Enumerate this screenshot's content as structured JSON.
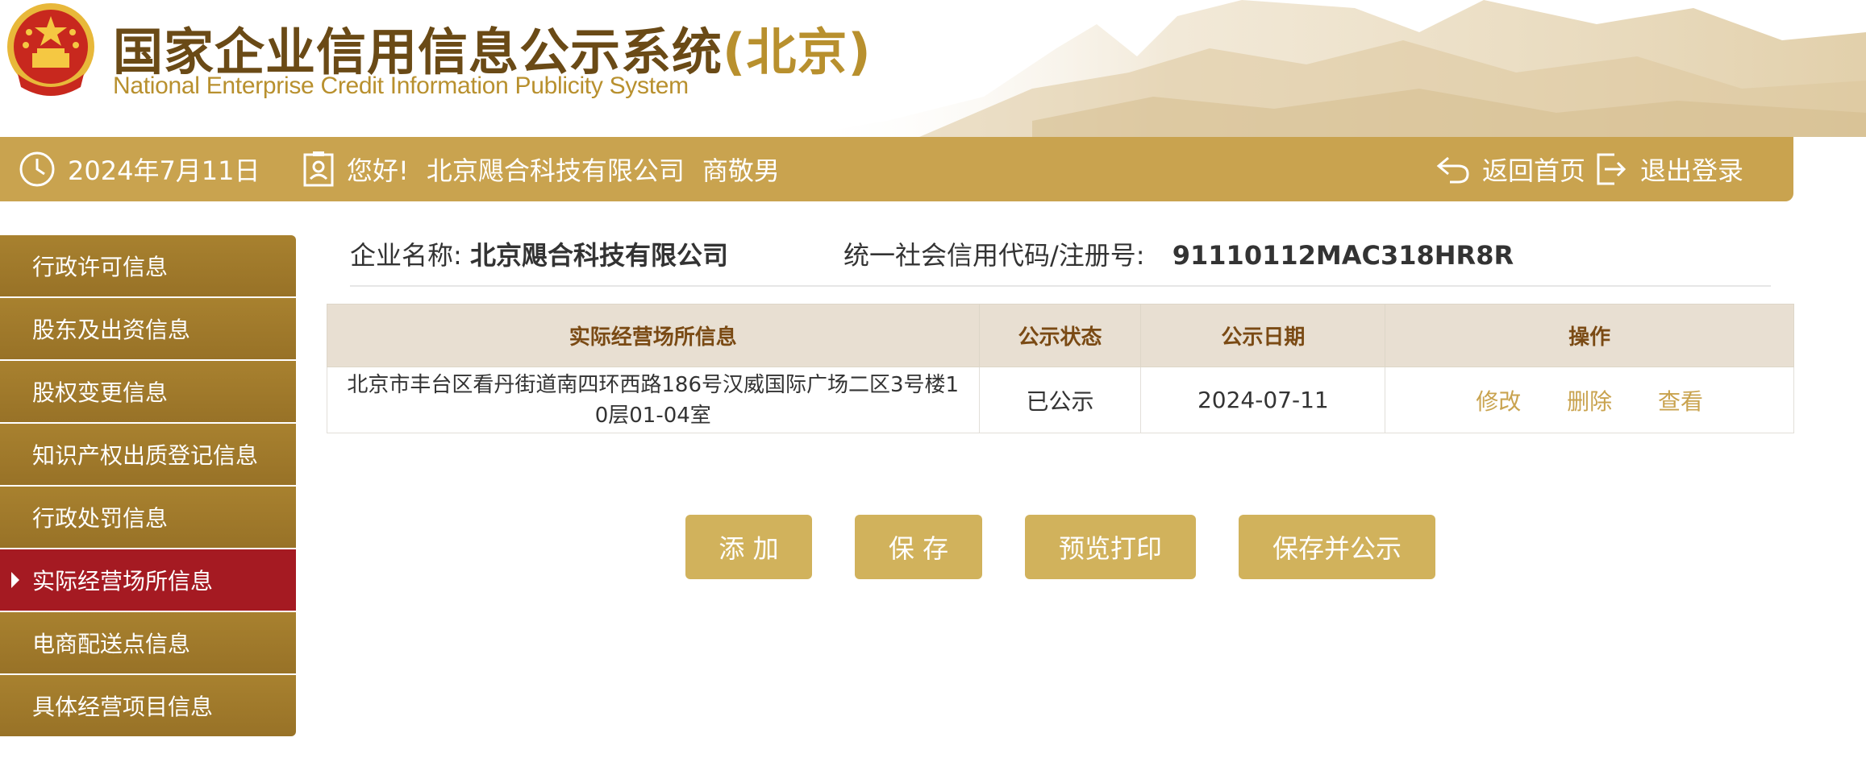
{
  "header": {
    "title_main": "国家企业信用信息公示系统",
    "title_region": "(北京)",
    "subtitle": "National Enterprise Credit Information Publicity System"
  },
  "infobar": {
    "date": "2024年7月11日",
    "greeting": "您好!",
    "company_name": "北京飓合科技有限公司",
    "user_name": "商敬男",
    "home_label": "返回首页",
    "logout_label": "退出登录"
  },
  "sidebar": {
    "items": [
      {
        "label": "行政许可信息"
      },
      {
        "label": "股东及出资信息"
      },
      {
        "label": "股权变更信息"
      },
      {
        "label": "知识产权出质登记信息"
      },
      {
        "label": "行政处罚信息"
      },
      {
        "label": "实际经营场所信息"
      },
      {
        "label": "电商配送点信息"
      },
      {
        "label": "具体经营项目信息"
      }
    ],
    "active_index": 5
  },
  "company": {
    "name_label": "企业名称:",
    "name_value": "北京飓合科技有限公司",
    "code_label": "统一社会信用代码/注册号:",
    "code_value": "91110112MAC318HR8R"
  },
  "table": {
    "headers": [
      "实际经营场所信息",
      "公示状态",
      "公示日期",
      "操作"
    ],
    "rows": [
      {
        "address_line1": "北京市丰台区看丹街道南四环西路186号汉威国际广场二区3号楼1",
        "address_line2": "0层01-04室",
        "status": "已公示",
        "date": "2024-07-11",
        "actions": [
          "修改",
          "删除",
          "查看"
        ]
      }
    ]
  },
  "buttons": {
    "add": "添 加",
    "save": "保 存",
    "preview_print": "预览打印",
    "save_publish": "保存并公示"
  },
  "colors": {
    "gold": "#c9a34f",
    "sidebar_gold": "#a07a2c",
    "active_red": "#a51a22",
    "header_brown": "#6a4a16"
  }
}
